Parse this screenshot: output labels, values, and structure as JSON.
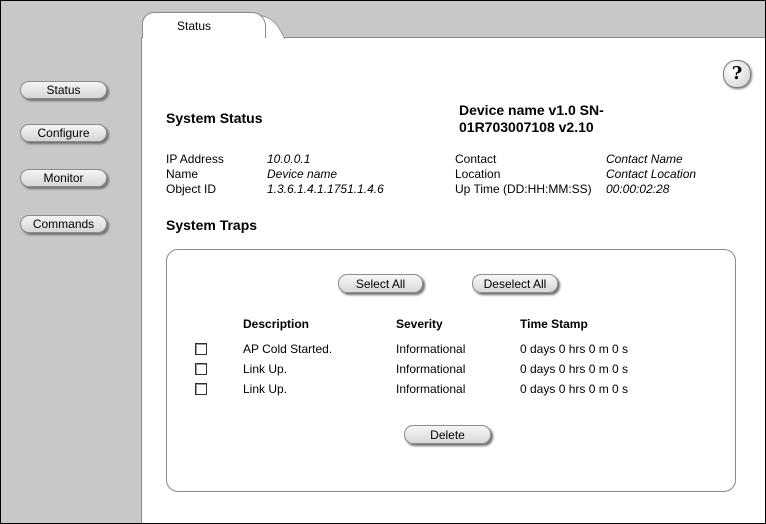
{
  "sidebar": {
    "buttons": [
      "Status",
      "Configure",
      "Monitor",
      "Commands"
    ]
  },
  "tab": {
    "label": "Status"
  },
  "help": {
    "symbol": "?"
  },
  "status": {
    "title": "System Status",
    "device_line1": "Device name v1.0  SN-",
    "device_line2": "01R703007108 v2.10",
    "left_labels": [
      "IP Address",
      "Name",
      "Object ID"
    ],
    "left_values": [
      "10.0.0.1",
      "Device name",
      "1.3.6.1.4.1.1751.1.4.6"
    ],
    "right_labels": [
      "Contact",
      "Location",
      "Up Time (DD:HH:MM:SS)"
    ],
    "right_values": [
      "Contact Name",
      "Contact Location",
      "00:00:02:28"
    ]
  },
  "traps": {
    "title": "System Traps",
    "select_all": "Select All",
    "deselect_all": "Deselect All",
    "columns": [
      "Description",
      "Severity",
      "Time Stamp"
    ],
    "rows": [
      [
        "AP Cold Started.",
        "Informational",
        "0 days 0 hrs 0 m 0 s"
      ],
      [
        "Link Up.",
        "Informational",
        "0 days 0 hrs 0 m 0 s"
      ],
      [
        "Link Up.",
        "Informational",
        "0 days 0 hrs 0 m 0 s"
      ]
    ],
    "delete": "Delete"
  }
}
